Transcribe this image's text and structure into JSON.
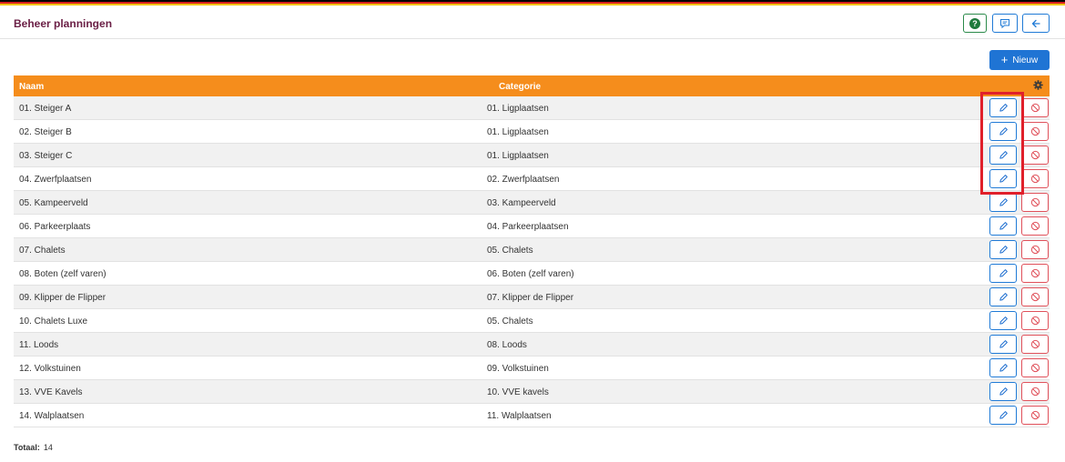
{
  "header": {
    "title": "Beheer planningen",
    "help_label": "?"
  },
  "toolbar": {
    "new_label": "Nieuw"
  },
  "table": {
    "columns": [
      "Naam",
      "Categorie"
    ],
    "rows": [
      {
        "naam": "01. Steiger A",
        "categorie": "01. Ligplaatsen"
      },
      {
        "naam": "02. Steiger B",
        "categorie": "01. Ligplaatsen"
      },
      {
        "naam": "03. Steiger C",
        "categorie": "01. Ligplaatsen"
      },
      {
        "naam": "04. Zwerfplaatsen",
        "categorie": "02. Zwerfplaatsen"
      },
      {
        "naam": "05. Kampeerveld",
        "categorie": "03. Kampeerveld"
      },
      {
        "naam": "06. Parkeerplaats",
        "categorie": "04. Parkeerplaatsen"
      },
      {
        "naam": "07. Chalets",
        "categorie": "05. Chalets"
      },
      {
        "naam": "08. Boten (zelf varen)",
        "categorie": "06. Boten (zelf varen)"
      },
      {
        "naam": "09. Klipper de Flipper",
        "categorie": "07. Klipper de Flipper"
      },
      {
        "naam": "10. Chalets Luxe",
        "categorie": "05. Chalets"
      },
      {
        "naam": "11. Loods",
        "categorie": "08. Loods"
      },
      {
        "naam": "12. Volkstuinen",
        "categorie": "09. Volkstuinen"
      },
      {
        "naam": "13. VVE Kavels",
        "categorie": "10. VVE kavels"
      },
      {
        "naam": "14. Walplaatsen",
        "categorie": "11. Walplaatsen"
      }
    ]
  },
  "footer": {
    "total_label": "Totaal:",
    "total_value": "14"
  },
  "icons": {
    "help": "help-icon",
    "chat": "comment-icon",
    "back": "arrow-left-icon",
    "settings": "gear-icon",
    "edit": "pencil-icon",
    "delete": "ban-icon"
  },
  "colors": {
    "title": "#6b2046",
    "table_header": "#f58d1c",
    "primary": "#1f74d4",
    "danger": "#e0505a",
    "success": "#1e7a3c",
    "highlight": "#e0202a"
  }
}
